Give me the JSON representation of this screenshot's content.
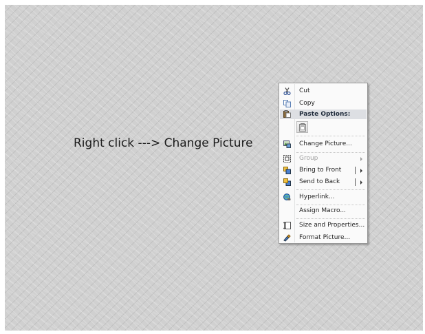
{
  "instruction_text": "Right click ---> Change Picture",
  "context_menu": {
    "items": [
      {
        "label": "Cut",
        "icon": "scissors-icon"
      },
      {
        "label": "Copy",
        "icon": "copy-icon"
      },
      {
        "label": "Paste Options:",
        "icon": "paste-icon"
      },
      {
        "label": "Change Picture...",
        "icon": "change-picture-icon"
      },
      {
        "label": "Group",
        "icon": "group-icon",
        "disabled": true
      },
      {
        "label": "Bring to Front",
        "icon": "bring-to-front-icon"
      },
      {
        "label": "Send to Back",
        "icon": "send-to-back-icon"
      },
      {
        "label": "Hyperlink...",
        "icon": "hyperlink-icon"
      },
      {
        "label": "Assign Macro...",
        "icon": ""
      },
      {
        "label": "Size and Properties...",
        "icon": "size-properties-icon"
      },
      {
        "label": "Format Picture...",
        "icon": "format-picture-icon"
      }
    ]
  },
  "colors": {
    "menu_background": "#fafafa",
    "menu_border": "#979797",
    "paste_header_background": "#dddfe3",
    "disabled_text": "#a0a0a0"
  }
}
